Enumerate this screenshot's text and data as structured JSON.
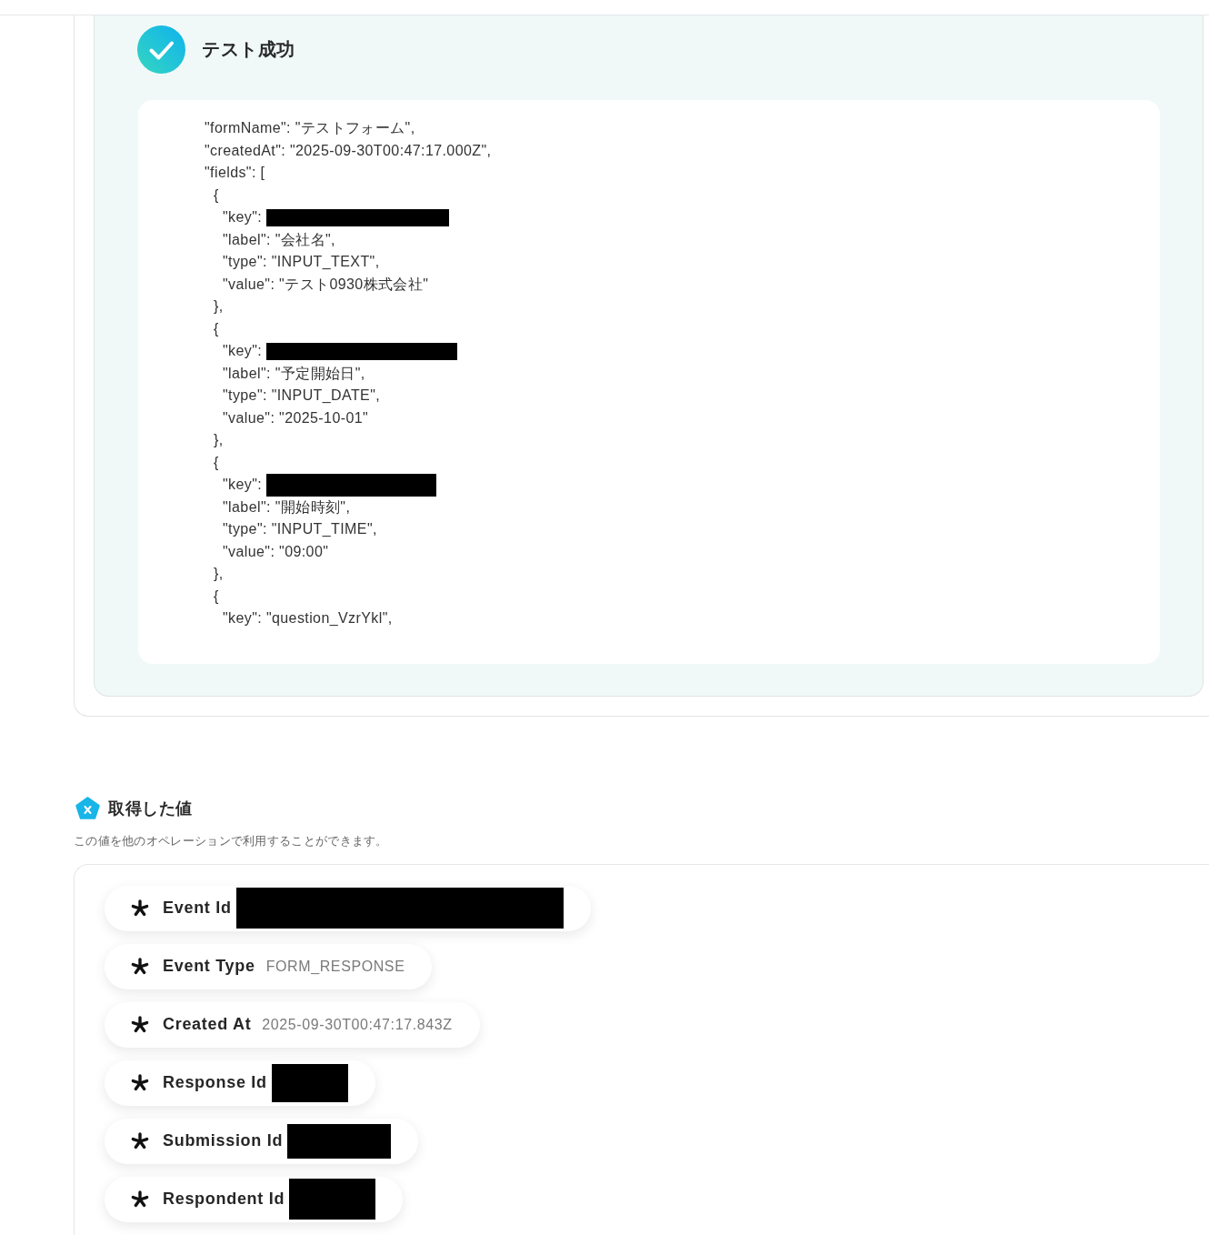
{
  "success_panel": {
    "title": "テスト成功",
    "code_lines": [
      {
        "kind": "text",
        "text": "\"formName\": \"テストフォーム\","
      },
      {
        "kind": "text",
        "text": "\"createdAt\": \"2025-09-30T00:47:17.000Z\","
      },
      {
        "kind": "text",
        "text": "\"fields\": [",
        "children": [
          {
            "kind": "text",
            "text": "{",
            "children": [
              {
                "kind": "redacted",
                "text": "\"key\":"
              },
              {
                "kind": "text",
                "text": "\"label\": \"会社名\","
              },
              {
                "kind": "text",
                "text": "\"type\": \"INPUT_TEXT\","
              },
              {
                "kind": "text",
                "text": "\"value\": \"テスト0930株式会社\""
              }
            ]
          },
          {
            "kind": "text",
            "text": "},"
          },
          {
            "kind": "text",
            "text": "{",
            "children": [
              {
                "kind": "redacted",
                "text": "\"key\":"
              },
              {
                "kind": "text",
                "text": "\"label\": \"予定開始日\","
              },
              {
                "kind": "text",
                "text": "\"type\": \"INPUT_DATE\","
              },
              {
                "kind": "text",
                "text": "\"value\": \"2025-10-01\""
              }
            ]
          },
          {
            "kind": "text",
            "text": "},"
          },
          {
            "kind": "text",
            "text": "{",
            "children": [
              {
                "kind": "redacted",
                "text": "\"key\":"
              },
              {
                "kind": "text",
                "text": "\"label\": \"開始時刻\","
              },
              {
                "kind": "text",
                "text": "\"type\": \"INPUT_TIME\","
              },
              {
                "kind": "text",
                "text": "\"value\": \"09:00\""
              }
            ]
          },
          {
            "kind": "text",
            "text": "},"
          },
          {
            "kind": "text",
            "text": "{",
            "children": [
              {
                "kind": "text",
                "text": "\"key\": \"question_VzrYkl\","
              }
            ]
          }
        ]
      }
    ]
  },
  "obtained_values": {
    "title": "取得した値",
    "description": "この値を他のオペレーションで利用することができます。",
    "items": [
      {
        "label": "Event Id",
        "kind": "redacted"
      },
      {
        "label": "Event Type",
        "kind": "text",
        "value": "FORM_RESPONSE"
      },
      {
        "label": "Created At",
        "kind": "text",
        "value": "2025-09-30T00:47:17.843Z"
      },
      {
        "label": "Response Id",
        "kind": "redacted"
      },
      {
        "label": "Submission Id",
        "kind": "redacted"
      },
      {
        "label": "Respondent Id",
        "kind": "redacted"
      }
    ]
  }
}
